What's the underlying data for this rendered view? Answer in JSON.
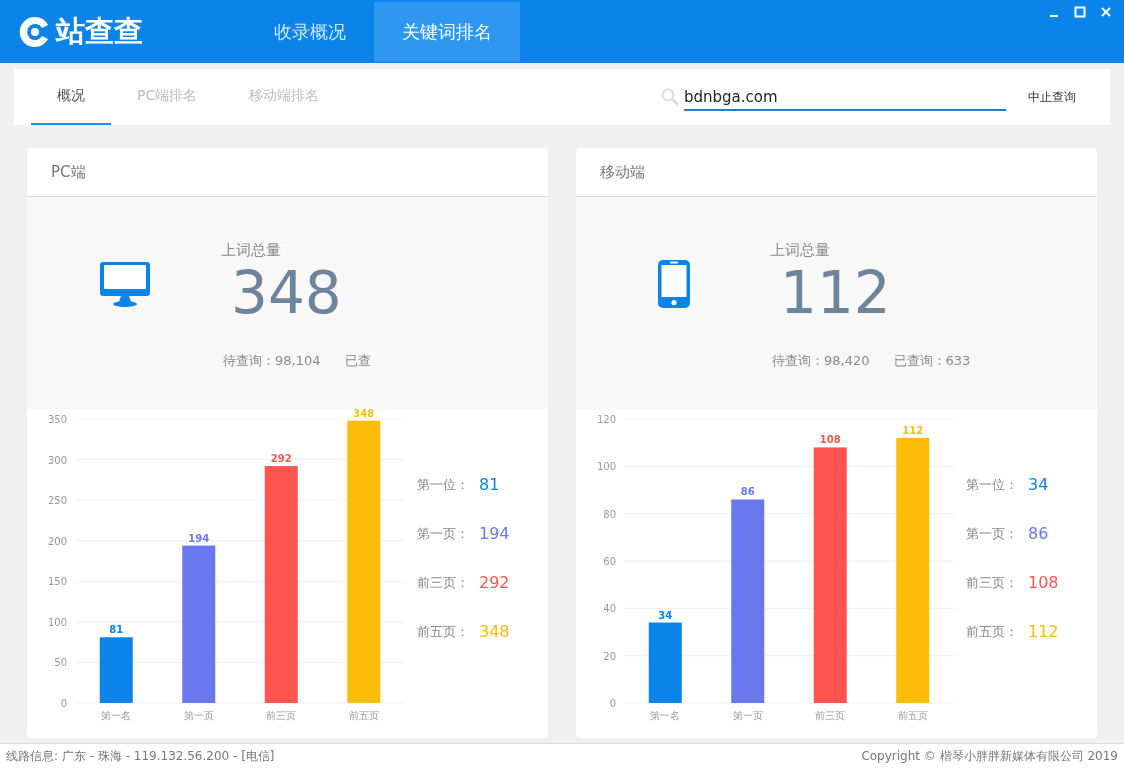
{
  "window": {
    "logo_text": "站查查"
  },
  "nav_tabs": [
    {
      "label": "收录概况",
      "selected": false
    },
    {
      "label": "关键词排名",
      "selected": true
    }
  ],
  "sub_tabs": [
    {
      "label": "概况",
      "selected": true
    },
    {
      "label": "PC端排名",
      "selected": false
    },
    {
      "label": "移动端排名",
      "selected": false
    }
  ],
  "search": {
    "value": "bdnbga.com",
    "button": "中止查询"
  },
  "panels": [
    {
      "title": "PC端",
      "kind": "desktop",
      "total_label": "上词总量",
      "total": "348",
      "pending": "待查询：98,104",
      "done": "已查",
      "legend": [
        {
          "label": "第一位：",
          "value": "81",
          "color": "#0a84ea"
        },
        {
          "label": "第一页：",
          "value": "194",
          "color": "#6978ee"
        },
        {
          "label": "前三页：",
          "value": "292",
          "color": "#ff5450"
        },
        {
          "label": "前五页：",
          "value": "348",
          "color": "#fbbd08"
        }
      ],
      "chart_data": {
        "type": "bar",
        "categories": [
          "第一名",
          "第一页",
          "前三页",
          "前五页"
        ],
        "values": [
          81,
          194,
          292,
          348
        ],
        "ylim": [
          0,
          350
        ],
        "yticks": [
          0,
          50,
          100,
          150,
          200,
          250,
          300,
          350
        ],
        "grid": true,
        "data_labels": true
      }
    },
    {
      "title": "移动端",
      "kind": "phone",
      "total_label": "上词总量",
      "total": "112",
      "pending": "待查询：98,420",
      "done": "已查询：633",
      "legend": [
        {
          "label": "第一位：",
          "value": "34",
          "color": "#0a84ea"
        },
        {
          "label": "第一页：",
          "value": "86",
          "color": "#6978ee"
        },
        {
          "label": "前三页：",
          "value": "108",
          "color": "#ff5450"
        },
        {
          "label": "前五页：",
          "value": "112",
          "color": "#fbbd08"
        }
      ],
      "chart_data": {
        "type": "bar",
        "categories": [
          "第一名",
          "第一页",
          "前三页",
          "前五页"
        ],
        "values": [
          34,
          86,
          108,
          112
        ],
        "ylim": [
          0,
          120
        ],
        "yticks": [
          0,
          20,
          40,
          60,
          80,
          100,
          120
        ],
        "grid": true,
        "data_labels": true
      }
    }
  ],
  "status_bar": {
    "line_info": "线路信息: 广东 - 珠海 - 119.132.56.200 - [电信]",
    "copyright": "Copyright © 楷琴小胖胖新媒体有限公司 2019"
  }
}
